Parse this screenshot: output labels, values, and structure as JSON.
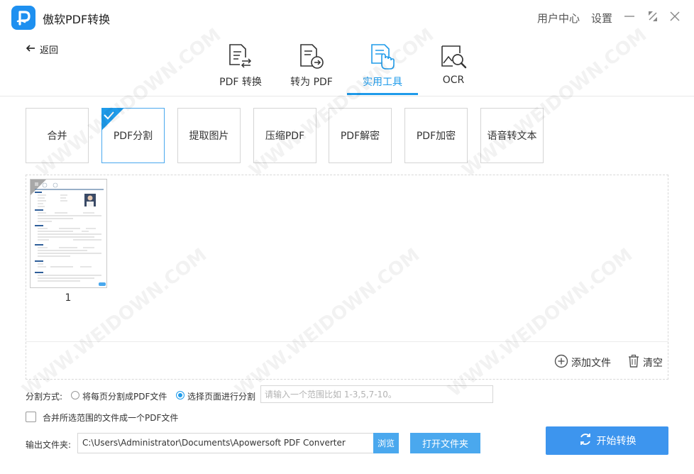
{
  "app": {
    "title": "傲软PDF转换",
    "brand_color": "#1e90f0",
    "accent_color": "#1f9bea"
  },
  "titlebar": {
    "user_center": "用户中心",
    "settings": "设置",
    "minimize_icon": "minimize-icon",
    "restore_icon": "restore-icon",
    "close_icon": "close-icon"
  },
  "back": {
    "label": "返回"
  },
  "main_tabs": [
    {
      "label": "PDF 转换",
      "icon": "pdf-convert-icon",
      "active": false
    },
    {
      "label": "转为 PDF",
      "icon": "to-pdf-icon",
      "active": false
    },
    {
      "label": "实用工具",
      "icon": "tools-icon",
      "active": true
    },
    {
      "label": "OCR",
      "icon": "ocr-icon",
      "active": false
    }
  ],
  "tools": [
    {
      "label": "合并",
      "active": false
    },
    {
      "label": "PDF分割",
      "active": true
    },
    {
      "label": "提取图片",
      "active": false
    },
    {
      "label": "压缩PDF",
      "active": false
    },
    {
      "label": "PDF解密",
      "active": false
    },
    {
      "label": "PDF加密",
      "active": false
    },
    {
      "label": "语音转文本",
      "active": false
    }
  ],
  "files": [
    {
      "page_number": "1"
    }
  ],
  "actions": {
    "add_file": "添加文件",
    "clear": "清空"
  },
  "split": {
    "label": "分割方式:",
    "option_each_page": "将每页分割成PDF文件",
    "option_select_pages": "选择页面进行分割",
    "selected": "select_pages",
    "range_placeholder": "请输入一个范围比如 1-3,5,7-10。"
  },
  "merge_option": {
    "label": "合并所选范围的文件成一个PDF文件",
    "checked": false
  },
  "output": {
    "label": "输出文件夹:",
    "path": "C:\\Users\\Administrator\\Documents\\Apowersoft PDF Converter",
    "browse": "浏览",
    "open_folder": "打开文件夹"
  },
  "start_button": {
    "label": "开始转换"
  },
  "watermark_text": "WWW.WEIDOWN.COM"
}
